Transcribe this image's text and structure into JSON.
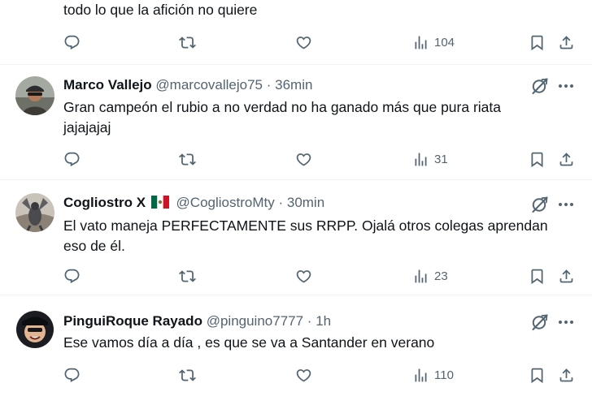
{
  "top_tweet": {
    "text": "todo lo que la afición no quiere",
    "views": "104"
  },
  "tweets": [
    {
      "name": "Marco Vallejo",
      "handle": "@marcovallejo75",
      "separator": "·",
      "time": "36min",
      "text": "Gran campeón el rubio a no verdad no ha ganado más que pura riata jajajajaj",
      "views": "31"
    },
    {
      "name": "Cogliostro X",
      "flag": "mexico-flag",
      "handle": "@CogliostroMty",
      "separator": "·",
      "time": "30min",
      "text": "El vato maneja PERFECTAMENTE sus RRPP. Ojalá otros colegas aprendan eso de él.",
      "views": "23"
    },
    {
      "name": "PinguiRoque Rayado",
      "handle": "@pinguino7777",
      "separator": "·",
      "time": "1h",
      "text": "Ese vamos día a día , es que se va a Santander en verano",
      "views": "110"
    }
  ],
  "icons": {
    "reply": "reply-icon",
    "retweet": "retweet-icon",
    "like": "like-icon",
    "views": "views-icon",
    "bookmark": "bookmark-icon",
    "share": "share-icon",
    "grok": "grok-icon",
    "more": "more-icon"
  },
  "colors": {
    "text": "#0f1419",
    "secondary": "#536471",
    "divider": "#eff3f4"
  }
}
